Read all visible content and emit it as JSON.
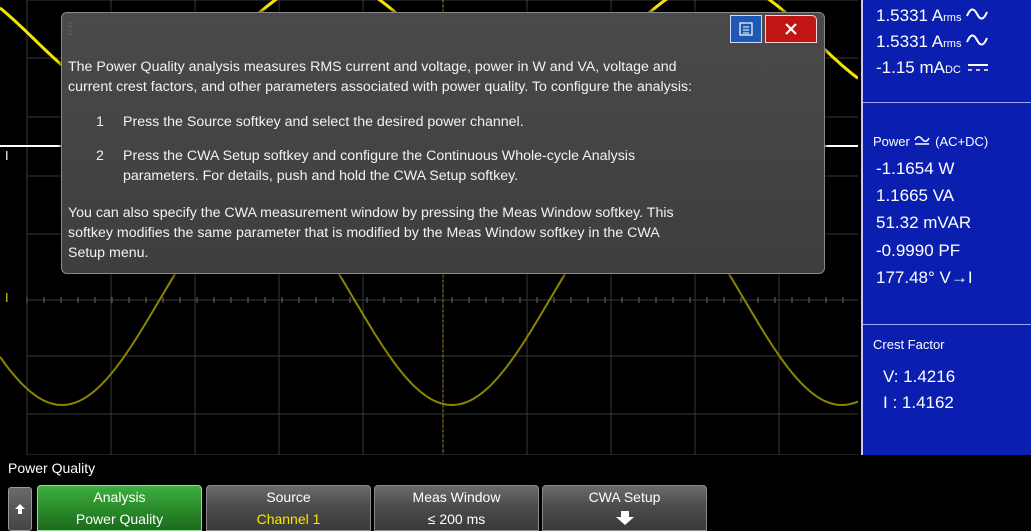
{
  "measurements": {
    "rms1_value": "1.5331 A",
    "rms1_unit": "rms",
    "rms2_value": "1.5331 A",
    "rms2_unit": "rms",
    "dc_value": "-1.15 mA",
    "dc_unit": "DC",
    "power_label": "Power",
    "power_mode": "(AC+DC)",
    "watts": "-1.1654 W",
    "va": "1.1665 VA",
    "var": "51.32 mVAR",
    "pf": "-0.9990 PF",
    "phase": "177.48° V→I",
    "crest_label": "Crest Factor",
    "crest_v": "V:  1.4216",
    "crest_i": "I :  1.4162"
  },
  "markers": {
    "ch_label": "I",
    "ground_label": "I"
  },
  "dialog": {
    "intro": [
      "The Power Quality analysis measures RMS current and voltage, power in W and VA, voltage and",
      "current crest factors, and other parameters associated with power quality. To configure the analysis:"
    ],
    "steps": [
      {
        "num": "1",
        "lines": [
          "Press the Source softkey and select the desired power channel."
        ]
      },
      {
        "num": "2",
        "lines": [
          "Press the  CWA Setup softkey and configure the Continuous Whole-cycle Analysis",
          "parameters. For details, push and hold the CWA Setup softkey."
        ]
      }
    ],
    "outro": [
      "You can also specify the CWA measurement window by pressing the Meas Window softkey. This",
      "softkey modifies the same parameter that is modified by the Meas Window softkey in the CWA",
      "Setup menu."
    ]
  },
  "menu": {
    "title": "Power Quality",
    "softkeys": [
      {
        "label": "Analysis",
        "value": "Power Quality"
      },
      {
        "label": "Source",
        "value": "Channel 1"
      },
      {
        "label": "Meas Window",
        "value": "≤ 200 ms"
      },
      {
        "label": "CWA Setup",
        "value": ""
      }
    ]
  },
  "colors": {
    "trace_yellow": "#f4e400",
    "trace_dim": "#8c8500",
    "panel_blue": "#0a1fb0",
    "softkey_green": "#2b8d2b",
    "value_yellow": "#ffe600"
  }
}
